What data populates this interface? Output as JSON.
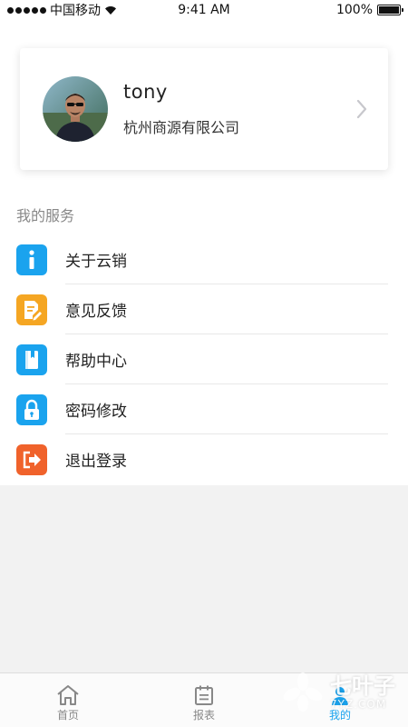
{
  "status_bar": {
    "carrier": "中国移动",
    "time": "9:41 AM",
    "battery": "100%"
  },
  "profile": {
    "name": "tony",
    "company": "杭州商源有限公司"
  },
  "services": {
    "title": "我的服务",
    "items": [
      {
        "label": "关于云销",
        "icon": "info-icon",
        "color": "#1aa3ee"
      },
      {
        "label": "意见反馈",
        "icon": "feedback-icon",
        "color": "#f5a623"
      },
      {
        "label": "帮助中心",
        "icon": "book-icon",
        "color": "#1aa3ee"
      },
      {
        "label": "密码修改",
        "icon": "lock-icon",
        "color": "#1aa3ee"
      },
      {
        "label": "退出登录",
        "icon": "logout-icon",
        "color": "#f0622b"
      }
    ]
  },
  "tabbar": {
    "tabs": [
      {
        "label": "首页",
        "icon": "home-icon",
        "active": false
      },
      {
        "label": "报表",
        "icon": "calendar-icon",
        "active": false
      },
      {
        "label": "我的",
        "icon": "person-icon",
        "active": true
      }
    ],
    "active_color": "#1aa3ee"
  },
  "watermark": {
    "main": "七叶子",
    "sub": "7YZ.COM"
  }
}
